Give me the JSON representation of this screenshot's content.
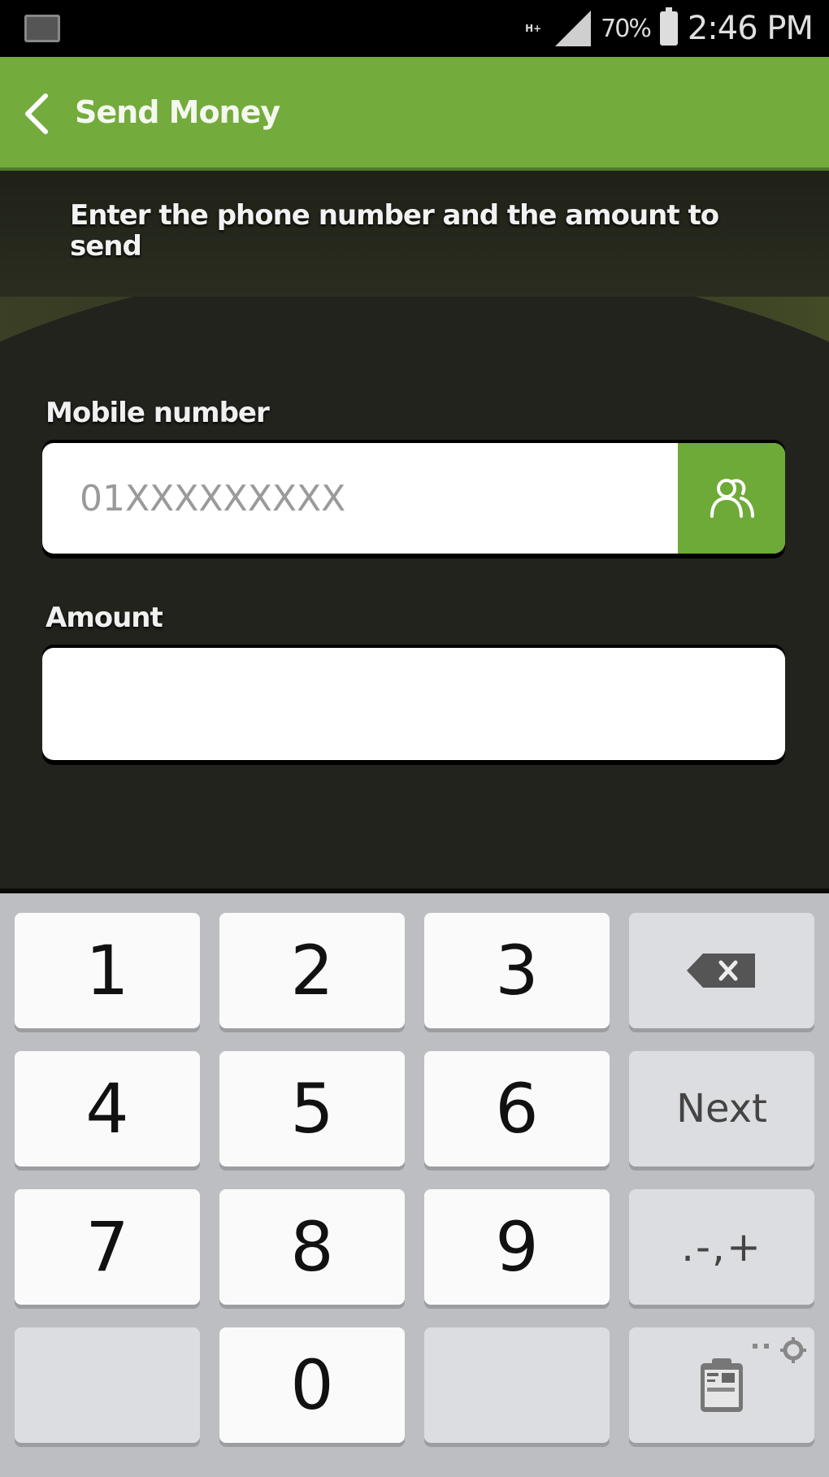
{
  "status_bar": {
    "left_icon": "keyboard-notification-icon",
    "network_type": "H+",
    "signal_icon": "signal-icon",
    "battery_percent": "70%",
    "battery_icon": "battery-charging-icon",
    "time": "2:46 PM"
  },
  "app_bar": {
    "back_icon": "chevron-left-icon",
    "title": "Send Money",
    "color": "#73ab3c"
  },
  "form": {
    "instructions": "Enter the phone number and the amount to send",
    "mobile_label": "Mobile number",
    "mobile_value": "",
    "mobile_placeholder": "01XXXXXXXXX",
    "contacts_icon": "contacts-icon",
    "amount_label": "Amount",
    "amount_value": "",
    "amount_placeholder": ""
  },
  "keyboard": {
    "keys": [
      {
        "label": "1"
      },
      {
        "label": "2"
      },
      {
        "label": "3"
      },
      {
        "label": "",
        "icon": "backspace-icon"
      },
      {
        "label": "4"
      },
      {
        "label": "5"
      },
      {
        "label": "6"
      },
      {
        "label": "Next"
      },
      {
        "label": "7"
      },
      {
        "label": "8"
      },
      {
        "label": "9"
      },
      {
        "label": ".-,+"
      },
      {
        "label": ""
      },
      {
        "label": "0"
      },
      {
        "label": ""
      },
      {
        "label": "",
        "icon": "clipboard-icon",
        "secondary_icon": "settings-icon"
      }
    ]
  }
}
